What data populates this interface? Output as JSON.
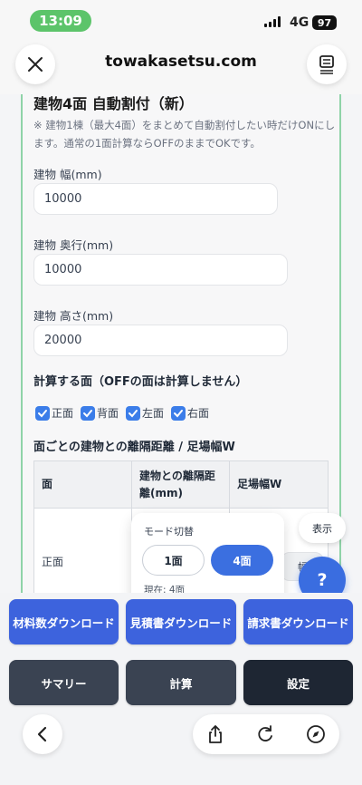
{
  "status_bar": {
    "time": "13:09",
    "network": "4G",
    "battery": "97"
  },
  "browser": {
    "url": "towakasetsu.com",
    "close_icon": "close-icon",
    "menu_icon": "menu-icon"
  },
  "section": {
    "title": "建物4面 自動割付（新）",
    "note": "※ 建物1棟（最大4面）をまとめて自動割付したい時だけONにします。通常の1面計算ならOFFのままでOKです。"
  },
  "fields": {
    "width": {
      "label": "建物 幅(mm)",
      "value": "10000"
    },
    "depth": {
      "label": "建物 奥行(mm)",
      "value": "10000"
    },
    "height": {
      "label": "建物 高さ(mm)",
      "value": "20000"
    }
  },
  "faces": {
    "heading": "計算する面（OFFの面は計算しません）",
    "items": [
      {
        "label": "正面",
        "checked": true
      },
      {
        "label": "背面",
        "checked": true
      },
      {
        "label": "左面",
        "checked": true
      },
      {
        "label": "右面",
        "checked": true
      }
    ]
  },
  "distance": {
    "heading": "面ごとの建物との離隔距離 / 足場幅W",
    "columns": [
      "面",
      "建物との離隔距離(mm)",
      "足場幅W"
    ],
    "rows": [
      {
        "face": "正面"
      }
    ],
    "partial_cell_text": "幅ぶ"
  },
  "mode_popover": {
    "title": "モード切替",
    "option_1": "1面",
    "option_4": "4面",
    "status": "現在: 4面",
    "selected": "4面"
  },
  "show_button": "表示",
  "help_button": "?",
  "actions": {
    "materials_download": "材料数ダウンロード",
    "estimate_download": "見積書ダウンロード",
    "invoice_download": "請求書ダウンロード",
    "summary": "サマリー",
    "calculate": "計算",
    "settings": "設定"
  },
  "colors": {
    "accent_blue": "#3d63dd",
    "slate": "#3a4352",
    "dark": "#1e2633",
    "card_border": "#8fd3a8"
  }
}
